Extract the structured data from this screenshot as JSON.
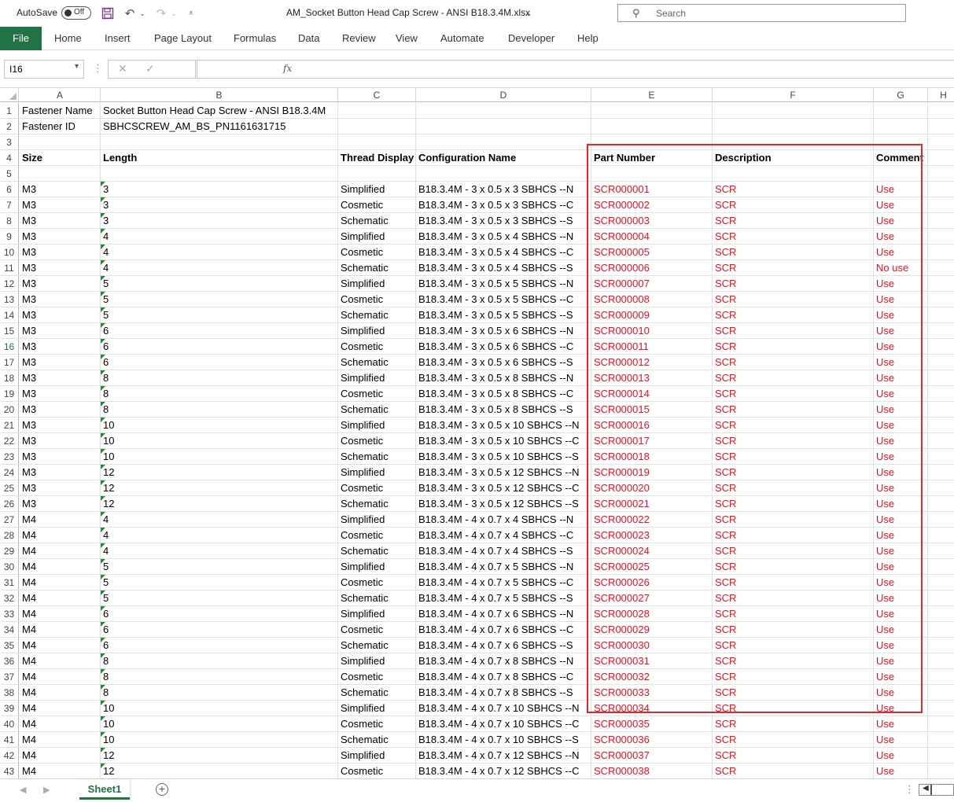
{
  "titlebar": {
    "autosave_label": "AutoSave",
    "autosave_state": "Off",
    "document_title": "AM_Socket Button Head Cap Screw - ANSI B18.3.4M.xlsx",
    "search_placeholder": "Search"
  },
  "ribbon": {
    "tabs": [
      "File",
      "Home",
      "Insert",
      "Page Layout",
      "Formulas",
      "Data",
      "Review",
      "View",
      "Automate",
      "Developer",
      "Help"
    ]
  },
  "formula_bar": {
    "name_box": "I16",
    "formula": ""
  },
  "columns": [
    "A",
    "B",
    "C",
    "D",
    "E",
    "F",
    "G",
    "H"
  ],
  "selected_row": 16,
  "rows": [
    {
      "n": 1,
      "a": "Fastener Name",
      "b": "Socket Button Head Cap Screw - ANSI B18.3.4M"
    },
    {
      "n": 2,
      "a": "Fastener ID",
      "b": "SBHCSCREW_AM_BS_PN1161631715"
    },
    {
      "n": 3
    },
    {
      "n": 4,
      "header": true,
      "a": "Size",
      "b": "Length",
      "c": "Thread Display",
      "d": "Configuration Name",
      "e": "Part Number",
      "f": "Description",
      "g": "Comment"
    },
    {
      "n": 5
    },
    {
      "n": 6,
      "a": "M3",
      "b": "3",
      "c": "Simplified",
      "d": "B18.3.4M - 3 x 0.5 x 3 SBHCS --N",
      "e": "SCR000001",
      "f": "SCR",
      "g": "Use"
    },
    {
      "n": 7,
      "a": "M3",
      "b": "3",
      "c": "Cosmetic",
      "d": "B18.3.4M - 3 x 0.5 x 3 SBHCS --C",
      "e": "SCR000002",
      "f": "SCR",
      "g": "Use"
    },
    {
      "n": 8,
      "a": "M3",
      "b": "3",
      "c": "Schematic",
      "d": "B18.3.4M - 3 x 0.5 x 3 SBHCS --S",
      "e": "SCR000003",
      "f": "SCR",
      "g": "Use"
    },
    {
      "n": 9,
      "a": "M3",
      "b": "4",
      "c": "Simplified",
      "d": "B18.3.4M - 3 x 0.5 x 4 SBHCS --N",
      "e": "SCR000004",
      "f": "SCR",
      "g": "Use"
    },
    {
      "n": 10,
      "a": "M3",
      "b": "4",
      "c": "Cosmetic",
      "d": "B18.3.4M - 3 x 0.5 x 4 SBHCS --C",
      "e": "SCR000005",
      "f": "SCR",
      "g": "Use"
    },
    {
      "n": 11,
      "a": "M3",
      "b": "4",
      "c": "Schematic",
      "d": "B18.3.4M - 3 x 0.5 x 4 SBHCS --S",
      "e": "SCR000006",
      "f": "SCR",
      "g": "No use"
    },
    {
      "n": 12,
      "a": "M3",
      "b": "5",
      "c": "Simplified",
      "d": "B18.3.4M - 3 x 0.5 x 5 SBHCS --N",
      "e": "SCR000007",
      "f": "SCR",
      "g": "Use"
    },
    {
      "n": 13,
      "a": "M3",
      "b": "5",
      "c": "Cosmetic",
      "d": "B18.3.4M - 3 x 0.5 x 5 SBHCS --C",
      "e": "SCR000008",
      "f": "SCR",
      "g": "Use"
    },
    {
      "n": 14,
      "a": "M3",
      "b": "5",
      "c": "Schematic",
      "d": "B18.3.4M - 3 x 0.5 x 5 SBHCS --S",
      "e": "SCR000009",
      "f": "SCR",
      "g": "Use"
    },
    {
      "n": 15,
      "a": "M3",
      "b": "6",
      "c": "Simplified",
      "d": "B18.3.4M - 3 x 0.5 x 6 SBHCS --N",
      "e": "SCR000010",
      "f": "SCR",
      "g": "Use"
    },
    {
      "n": 16,
      "a": "M3",
      "b": "6",
      "c": "Cosmetic",
      "d": "B18.3.4M - 3 x 0.5 x 6 SBHCS --C",
      "e": "SCR000011",
      "f": "SCR",
      "g": "Use"
    },
    {
      "n": 17,
      "a": "M3",
      "b": "6",
      "c": "Schematic",
      "d": "B18.3.4M - 3 x 0.5 x 6 SBHCS --S",
      "e": "SCR000012",
      "f": "SCR",
      "g": "Use"
    },
    {
      "n": 18,
      "a": "M3",
      "b": "8",
      "c": "Simplified",
      "d": "B18.3.4M - 3 x 0.5 x 8 SBHCS --N",
      "e": "SCR000013",
      "f": "SCR",
      "g": "Use"
    },
    {
      "n": 19,
      "a": "M3",
      "b": "8",
      "c": "Cosmetic",
      "d": "B18.3.4M - 3 x 0.5 x 8 SBHCS --C",
      "e": "SCR000014",
      "f": "SCR",
      "g": "Use"
    },
    {
      "n": 20,
      "a": "M3",
      "b": "8",
      "c": "Schematic",
      "d": "B18.3.4M - 3 x 0.5 x 8 SBHCS --S",
      "e": "SCR000015",
      "f": "SCR",
      "g": "Use"
    },
    {
      "n": 21,
      "a": "M3",
      "b": "10",
      "c": "Simplified",
      "d": "B18.3.4M - 3 x 0.5 x 10 SBHCS --N",
      "e": "SCR000016",
      "f": "SCR",
      "g": "Use"
    },
    {
      "n": 22,
      "a": "M3",
      "b": "10",
      "c": "Cosmetic",
      "d": "B18.3.4M - 3 x 0.5 x 10 SBHCS --C",
      "e": "SCR000017",
      "f": "SCR",
      "g": "Use"
    },
    {
      "n": 23,
      "a": "M3",
      "b": "10",
      "c": "Schematic",
      "d": "B18.3.4M - 3 x 0.5 x 10 SBHCS --S",
      "e": "SCR000018",
      "f": "SCR",
      "g": "Use"
    },
    {
      "n": 24,
      "a": "M3",
      "b": "12",
      "c": "Simplified",
      "d": "B18.3.4M - 3 x 0.5 x 12 SBHCS --N",
      "e": "SCR000019",
      "f": "SCR",
      "g": "Use"
    },
    {
      "n": 25,
      "a": "M3",
      "b": "12",
      "c": "Cosmetic",
      "d": "B18.3.4M - 3 x 0.5 x 12 SBHCS --C",
      "e": "SCR000020",
      "f": "SCR",
      "g": "Use"
    },
    {
      "n": 26,
      "a": "M3",
      "b": "12",
      "c": "Schematic",
      "d": "B18.3.4M - 3 x 0.5 x 12 SBHCS --S",
      "e": "SCR000021",
      "f": "SCR",
      "g": "Use"
    },
    {
      "n": 27,
      "a": "M4",
      "b": "4",
      "c": "Simplified",
      "d": "B18.3.4M - 4 x 0.7 x 4 SBHCS --N",
      "e": "SCR000022",
      "f": "SCR",
      "g": "Use"
    },
    {
      "n": 28,
      "a": "M4",
      "b": "4",
      "c": "Cosmetic",
      "d": "B18.3.4M - 4 x 0.7 x 4 SBHCS --C",
      "e": "SCR000023",
      "f": "SCR",
      "g": "Use"
    },
    {
      "n": 29,
      "a": "M4",
      "b": "4",
      "c": "Schematic",
      "d": "B18.3.4M - 4 x 0.7 x 4 SBHCS --S",
      "e": "SCR000024",
      "f": "SCR",
      "g": "Use"
    },
    {
      "n": 30,
      "a": "M4",
      "b": "5",
      "c": "Simplified",
      "d": "B18.3.4M - 4 x 0.7 x 5 SBHCS --N",
      "e": "SCR000025",
      "f": "SCR",
      "g": "Use"
    },
    {
      "n": 31,
      "a": "M4",
      "b": "5",
      "c": "Cosmetic",
      "d": "B18.3.4M - 4 x 0.7 x 5 SBHCS --C",
      "e": "SCR000026",
      "f": "SCR",
      "g": "Use"
    },
    {
      "n": 32,
      "a": "M4",
      "b": "5",
      "c": "Schematic",
      "d": "B18.3.4M - 4 x 0.7 x 5 SBHCS --S",
      "e": "SCR000027",
      "f": "SCR",
      "g": "Use"
    },
    {
      "n": 33,
      "a": "M4",
      "b": "6",
      "c": "Simplified",
      "d": "B18.3.4M - 4 x 0.7 x 6 SBHCS --N",
      "e": "SCR000028",
      "f": "SCR",
      "g": "Use"
    },
    {
      "n": 34,
      "a": "M4",
      "b": "6",
      "c": "Cosmetic",
      "d": "B18.3.4M - 4 x 0.7 x 6 SBHCS --C",
      "e": "SCR000029",
      "f": "SCR",
      "g": "Use"
    },
    {
      "n": 35,
      "a": "M4",
      "b": "6",
      "c": "Schematic",
      "d": "B18.3.4M - 4 x 0.7 x 6 SBHCS --S",
      "e": "SCR000030",
      "f": "SCR",
      "g": "Use"
    },
    {
      "n": 36,
      "a": "M4",
      "b": "8",
      "c": "Simplified",
      "d": "B18.3.4M - 4 x 0.7 x 8 SBHCS --N",
      "e": "SCR000031",
      "f": "SCR",
      "g": "Use"
    },
    {
      "n": 37,
      "a": "M4",
      "b": "8",
      "c": "Cosmetic",
      "d": "B18.3.4M - 4 x 0.7 x 8 SBHCS --C",
      "e": "SCR000032",
      "f": "SCR",
      "g": "Use"
    },
    {
      "n": 38,
      "a": "M4",
      "b": "8",
      "c": "Schematic",
      "d": "B18.3.4M - 4 x 0.7 x 8 SBHCS --S",
      "e": "SCR000033",
      "f": "SCR",
      "g": "Use"
    },
    {
      "n": 39,
      "a": "M4",
      "b": "10",
      "c": "Simplified",
      "d": "B18.3.4M - 4 x 0.7 x 10 SBHCS --N",
      "e": "SCR000034",
      "f": "SCR",
      "g": "Use"
    },
    {
      "n": 40,
      "a": "M4",
      "b": "10",
      "c": "Cosmetic",
      "d": "B18.3.4M - 4 x 0.7 x 10 SBHCS --C",
      "e": "SCR000035",
      "f": "SCR",
      "g": "Use"
    },
    {
      "n": 41,
      "a": "M4",
      "b": "10",
      "c": "Schematic",
      "d": "B18.3.4M - 4 x 0.7 x 10 SBHCS --S",
      "e": "SCR000036",
      "f": "SCR",
      "g": "Use"
    },
    {
      "n": 42,
      "a": "M4",
      "b": "12",
      "c": "Simplified",
      "d": "B18.3.4M - 4 x 0.7 x 12 SBHCS --N",
      "e": "SCR000037",
      "f": "SCR",
      "g": "Use"
    },
    {
      "n": 43,
      "a": "M4",
      "b": "12",
      "c": "Cosmetic",
      "d": "B18.3.4M - 4 x 0.7 x 12 SBHCS --C",
      "e": "SCR000038",
      "f": "SCR",
      "g": "Use"
    }
  ],
  "sheets": {
    "active": "Sheet1"
  },
  "colors": {
    "excel_green": "#217346",
    "red_text": "#e81123",
    "highlight_border": "#e02828"
  }
}
